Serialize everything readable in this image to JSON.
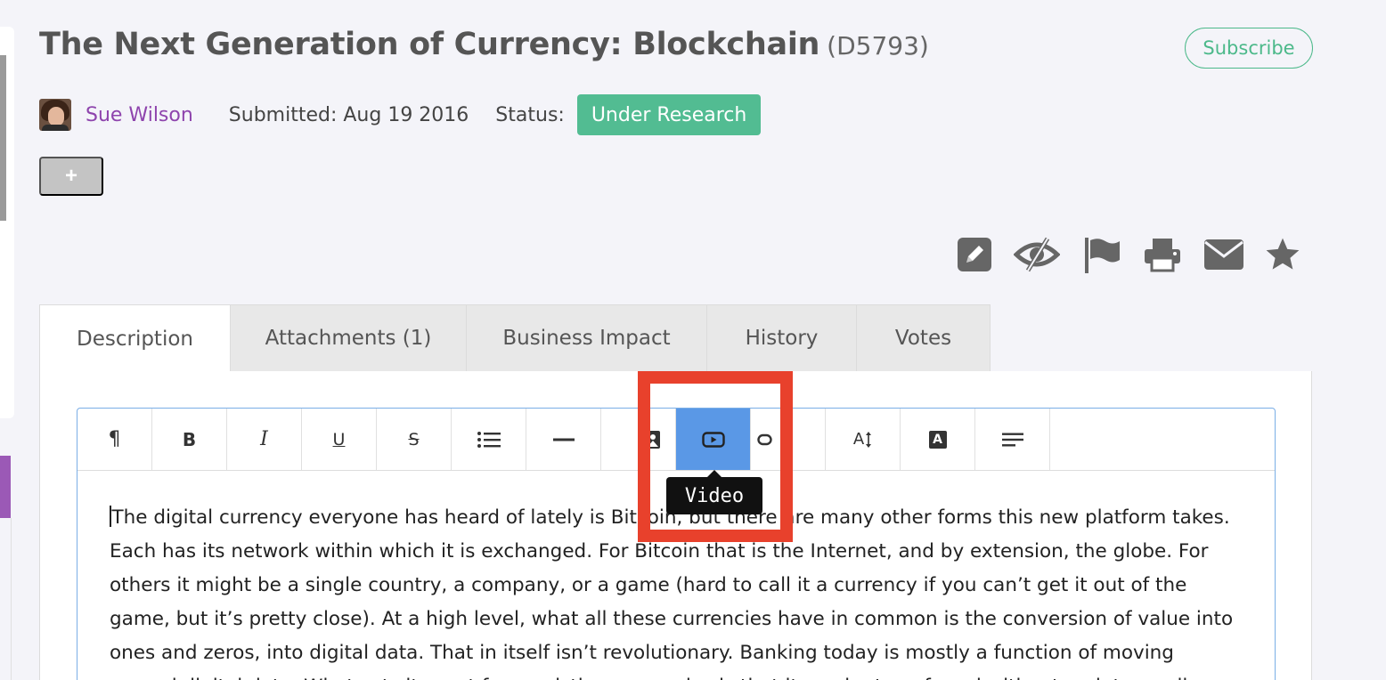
{
  "header": {
    "title": "The Next Generation of Currency: Blockchain",
    "id_label": "(D5793)",
    "subscribe_label": "Subscribe"
  },
  "meta": {
    "author": "Sue Wilson",
    "submitted": "Submitted: Aug 19 2016",
    "status_label": "Status:",
    "status_value": "Under Research",
    "status_color": "#52bc92"
  },
  "add_button": {
    "label": "+"
  },
  "actions": [
    {
      "name": "edit-icon"
    },
    {
      "name": "hide-icon"
    },
    {
      "name": "flag-icon"
    },
    {
      "name": "print-icon"
    },
    {
      "name": "email-icon"
    },
    {
      "name": "star-icon"
    }
  ],
  "tabs": [
    {
      "label": "Description",
      "active": true
    },
    {
      "label": "Attachments (1)",
      "active": false
    },
    {
      "label": "Business Impact",
      "active": false
    },
    {
      "label": "History",
      "active": false
    },
    {
      "label": "Votes",
      "active": false
    }
  ],
  "toolbar": {
    "items": [
      {
        "name": "paragraph-icon",
        "glyph": "¶"
      },
      {
        "name": "bold-icon",
        "glyph": "B"
      },
      {
        "name": "italic-icon",
        "glyph": "I"
      },
      {
        "name": "underline-icon",
        "glyph": "U"
      },
      {
        "name": "strikethrough-icon",
        "glyph": "S"
      },
      {
        "name": "list-icon"
      },
      {
        "name": "horizontal-rule-icon"
      },
      {
        "name": "image-icon"
      },
      {
        "name": "video-icon",
        "active": true
      },
      {
        "name": "link-icon"
      },
      {
        "name": "font-size-icon",
        "glyph": "A"
      },
      {
        "name": "font-color-icon",
        "glyph": "A"
      },
      {
        "name": "align-icon"
      }
    ],
    "tooltip": "Video",
    "active_color": "#5a98e6"
  },
  "editor": {
    "content": "The digital currency everyone has heard of lately is Bitcoin, but there are many other forms this new platform takes. Each has its network within which it is exchanged. For Bitcoin that is the Internet, and by extension, the globe. For others it might be a single country, a company, or a game (hard to call it a currency if you can’t get it out of the game, but it’s pretty close). At a high level, what all these currencies have in common is the conversion of value into ones and zeros, into digital data. That in itself isn’t revolutionary. Banking today is mostly a function of moving around digital data. What sets it apart from existing currencies is that it can be transferred without an intermediary."
  },
  "highlight_color": "#e8412c"
}
